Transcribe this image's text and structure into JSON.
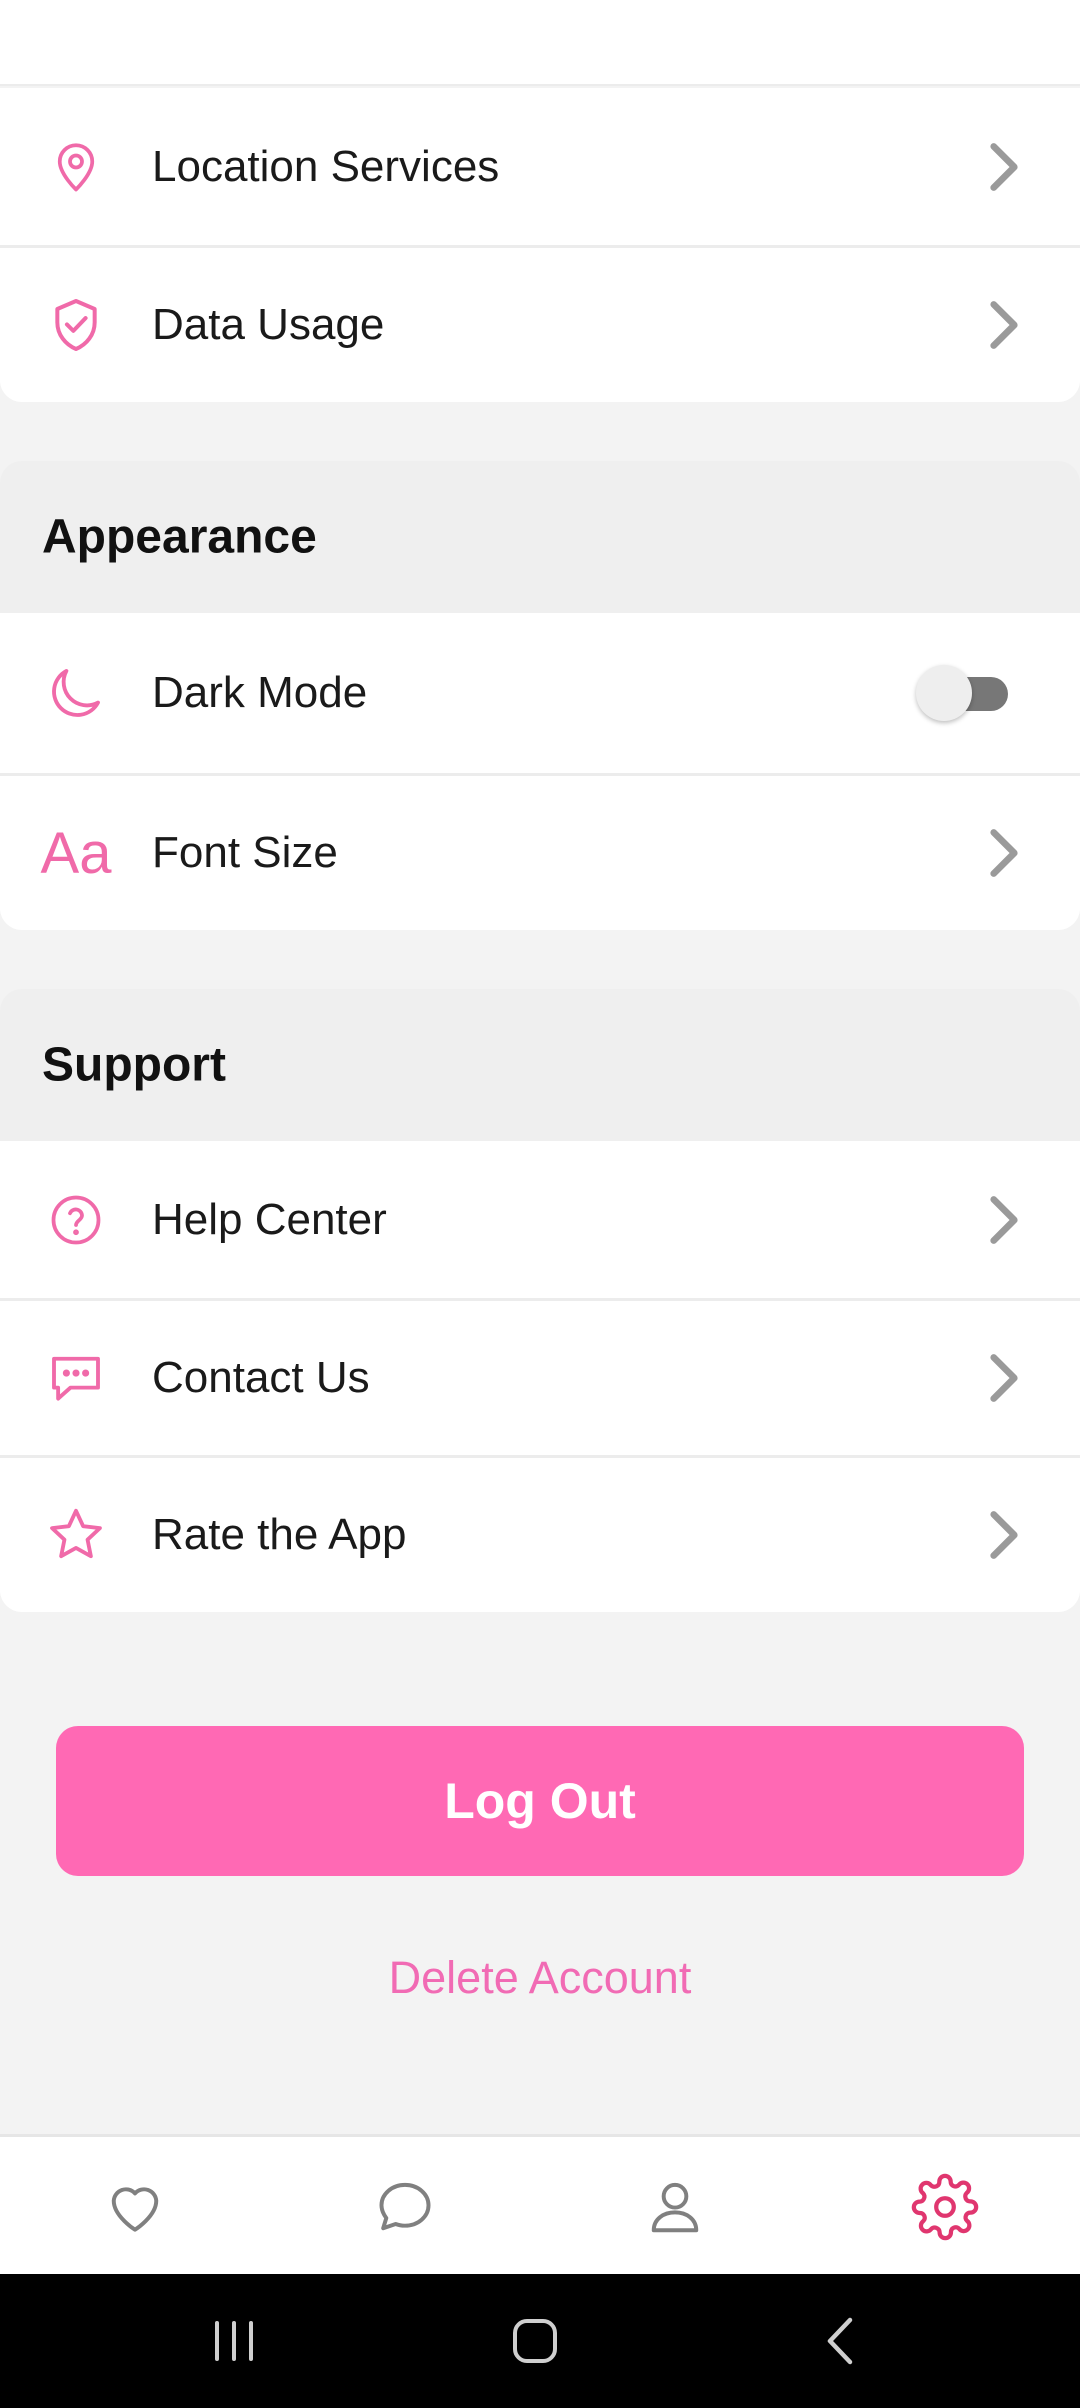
{
  "colors": {
    "accent": "#ff69b4",
    "icon_pink": "#f06aa9",
    "active_nav": "#e0366f",
    "background": "#f3f3f3"
  },
  "privacy": {
    "items": [
      {
        "label": "Location Services",
        "icon": "location-pin-icon"
      },
      {
        "label": "Data Usage",
        "icon": "shield-check-icon"
      }
    ]
  },
  "appearance": {
    "title": "Appearance",
    "dark_mode_label": "Dark Mode",
    "dark_mode_on": false,
    "font_size_label": "Font Size",
    "font_size_icon_text": "Aa"
  },
  "support": {
    "title": "Support",
    "items": [
      {
        "label": "Help Center",
        "icon": "help-circle-icon"
      },
      {
        "label": "Contact Us",
        "icon": "chat-bubble-icon"
      },
      {
        "label": "Rate the App",
        "icon": "star-icon"
      }
    ]
  },
  "actions": {
    "logout_label": "Log Out",
    "delete_label": "Delete Account"
  },
  "bottom_nav": {
    "items": [
      {
        "icon": "heart-icon",
        "active": false
      },
      {
        "icon": "chat-icon",
        "active": false
      },
      {
        "icon": "profile-icon",
        "active": false
      },
      {
        "icon": "gear-icon",
        "active": true
      }
    ]
  }
}
